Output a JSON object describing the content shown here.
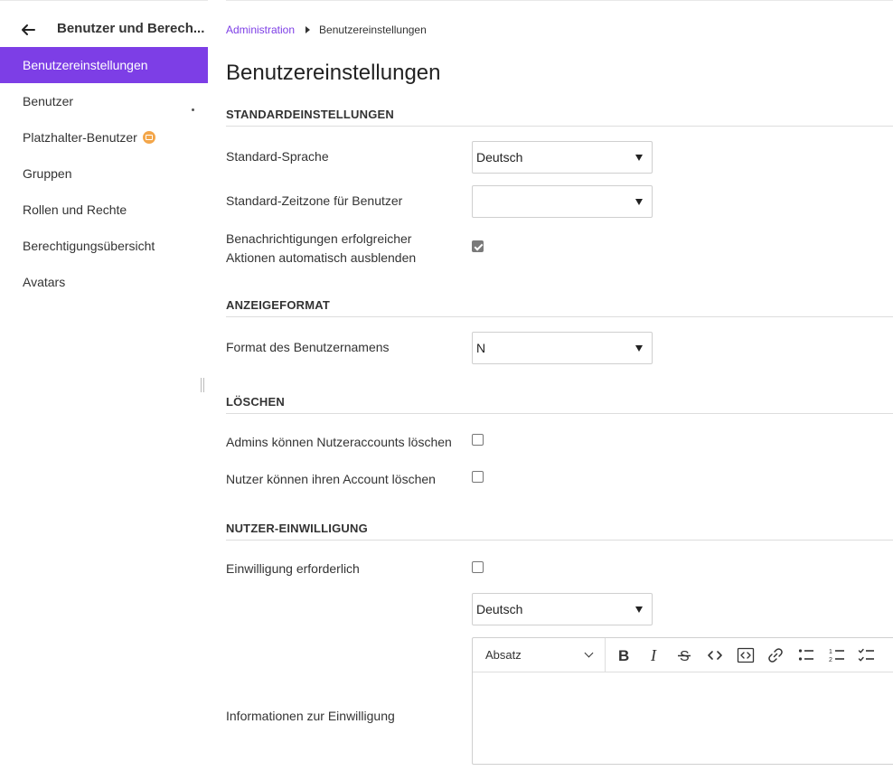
{
  "sidebar": {
    "title": "Benutzer und Berech...",
    "items": [
      {
        "label": "Benutzereinstellungen"
      },
      {
        "label": "Benutzer"
      },
      {
        "label": "Platzhalter-Benutzer"
      },
      {
        "label": "Gruppen"
      },
      {
        "label": "Rollen und Rechte"
      },
      {
        "label": "Berechtigungsübersicht"
      },
      {
        "label": "Avatars"
      }
    ]
  },
  "breadcrumb": {
    "parent": "Administration",
    "current": "Benutzereinstellungen"
  },
  "page": {
    "title": "Benutzereinstellungen"
  },
  "sections": {
    "defaults": {
      "heading": "STANDARDEINSTELLUNGEN",
      "language_label": "Standard-Sprache",
      "language_value": "Deutsch",
      "timezone_label": "Standard-Zeitzone für Benutzer",
      "timezone_value": "",
      "notifications_label_line1": "Benachrichtigungen erfolgreicher",
      "notifications_label_line2": "Aktionen automatisch ausblenden",
      "notifications_checked": true
    },
    "display": {
      "heading": "ANZEIGEFORMAT",
      "username_format_label": "Format des Benutzernamens",
      "username_format_value": "N"
    },
    "deletion": {
      "heading": "LÖSCHEN",
      "admins_delete_label": "Admins können Nutzeraccounts löschen",
      "admins_delete_checked": false,
      "users_delete_label": "Nutzer können ihren Account löschen",
      "users_delete_checked": false
    },
    "consent": {
      "heading": "NUTZER-EINWILLIGUNG",
      "required_label": "Einwilligung erforderlich",
      "required_checked": false,
      "language_value": "Deutsch",
      "info_label": "Informationen zur Einwilligung",
      "editor": {
        "paragraph_style": "Absatz",
        "tools": [
          "bold-icon",
          "italic-icon",
          "strikethrough-icon",
          "code-icon",
          "code-block-icon",
          "link-icon",
          "bulleted-list-icon",
          "numbered-list-icon",
          "task-list-icon"
        ]
      }
    }
  },
  "colors": {
    "accent": "#7d3ee6",
    "text": "#333333",
    "divider": "#dddddd"
  }
}
